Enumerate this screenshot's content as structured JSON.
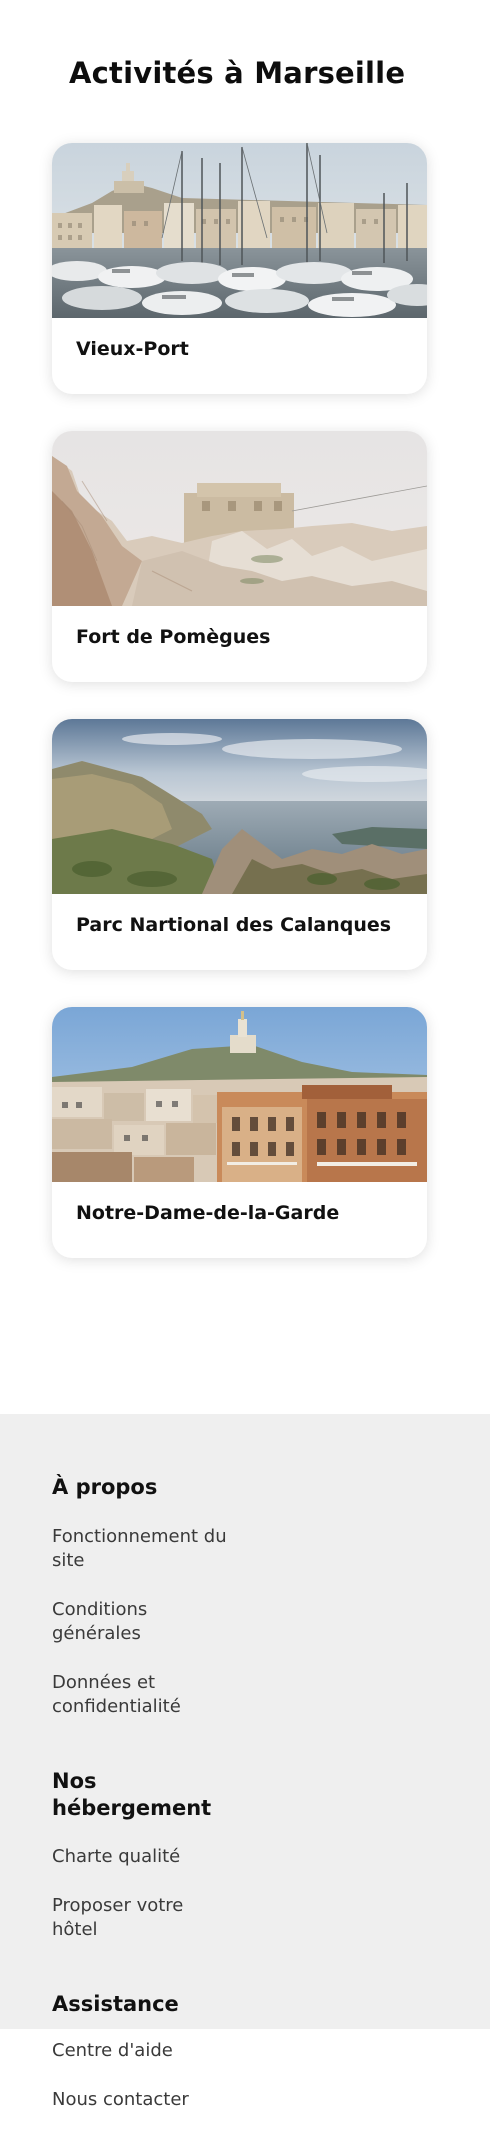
{
  "page": {
    "title": "Activités à Marseille"
  },
  "activities": [
    {
      "name": "Vieux-Port",
      "image_icon": "harbour-boats-photo"
    },
    {
      "name": "Fort de Pomègues",
      "image_icon": "stone-fort-photo"
    },
    {
      "name": "Parc Nartional des Calanques",
      "image_icon": "coastal-cliffs-photo"
    },
    {
      "name": "Notre-Dame-de-la-Garde",
      "image_icon": "city-basilica-photo"
    }
  ],
  "footer": {
    "about": {
      "heading": "À propos",
      "links": [
        "Fonctionnement du site",
        "Conditions générales",
        "Données et confidentialité"
      ]
    },
    "accommodation": {
      "heading": "Nos hébergement",
      "links": [
        "Charte qualité",
        "Proposer votre hôtel"
      ]
    },
    "support": {
      "heading": "Assistance",
      "links": [
        "Centre d'aide",
        "Nous contacter"
      ]
    }
  },
  "colors": {
    "card_shadow": "#dcdcdc",
    "footer_background": "#efefef",
    "text_primary": "#111111",
    "text_secondary": "#3a3a3a"
  }
}
